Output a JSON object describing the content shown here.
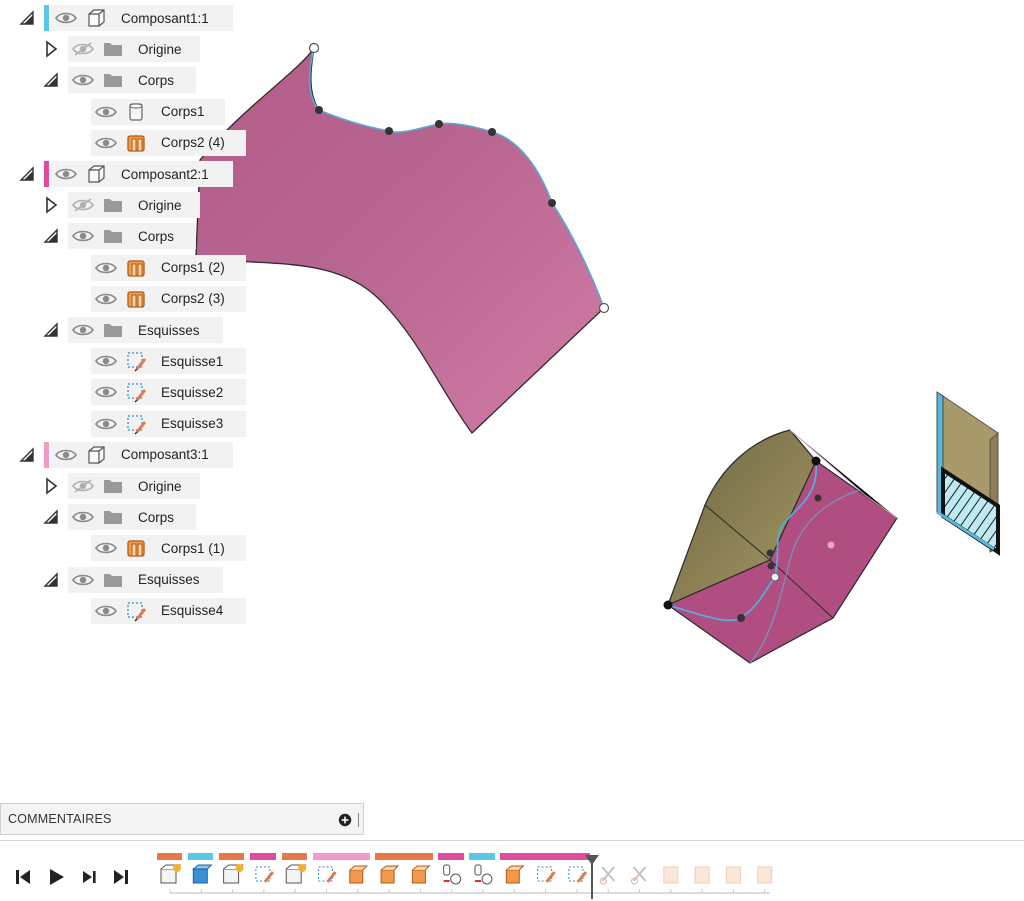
{
  "browser": {
    "nodes": [
      {
        "label": "Composant1:1",
        "color": "#5bc8e8"
      },
      {
        "label": "Origine"
      },
      {
        "label": "Corps"
      },
      {
        "label": "Corps1"
      },
      {
        "label": "Corps2 (4)"
      },
      {
        "label": "Composant2:1",
        "color": "#e04c9c"
      },
      {
        "label": "Origine"
      },
      {
        "label": "Corps"
      },
      {
        "label": "Corps1 (2)"
      },
      {
        "label": "Corps2 (3)"
      },
      {
        "label": "Esquisses"
      },
      {
        "label": "Esquisse1"
      },
      {
        "label": "Esquisse2"
      },
      {
        "label": "Esquisse3"
      },
      {
        "label": "Composant3:1",
        "color": "#f29ac8"
      },
      {
        "label": "Origine"
      },
      {
        "label": "Corps"
      },
      {
        "label": "Corps1 (1)"
      },
      {
        "label": "Esquisses"
      },
      {
        "label": "Esquisse4"
      }
    ]
  },
  "comments": {
    "label": "COMMENTAIRES"
  },
  "icons": {
    "eye": "eye-icon",
    "eye_hidden": "eye-hidden-icon",
    "component": "component-icon",
    "folder": "folder-icon",
    "body": "body-icon",
    "sketch": "sketch-icon",
    "add": "plus-circle-icon"
  },
  "colors": {
    "surface": "#c86a98",
    "solid_side": "#8c7d50",
    "accent_blue": "#5bc8e8",
    "accent_pink": "#e04c9c",
    "accent_light_pink": "#f29ac8",
    "accent_orange": "#e8774a"
  }
}
